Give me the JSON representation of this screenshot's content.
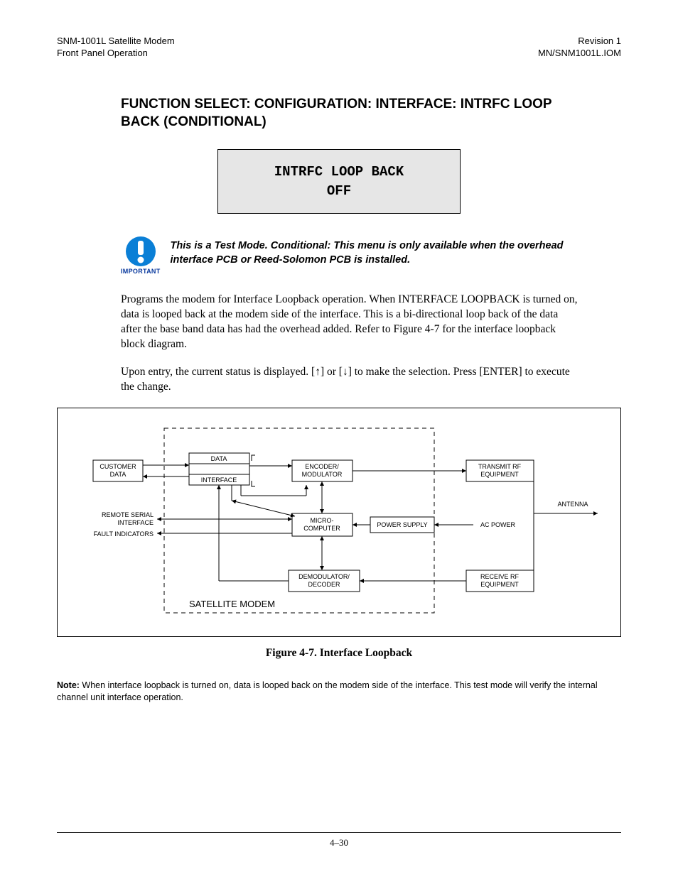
{
  "header": {
    "left1": "SNM-1001L Satellite Modem",
    "left2": "Front Panel Operation",
    "right1": "Revision 1",
    "right2": "MN/SNM1001L.IOM"
  },
  "title": "FUNCTION SELECT: CONFIGURATION: INTERFACE: INTRFC LOOP BACK (CONDITIONAL)",
  "lcd": {
    "line1": "INTRFC LOOP BACK",
    "line2": "OFF"
  },
  "important": {
    "label": "IMPORTANT",
    "text": "This is a Test Mode. Conditional: This menu is only available when the overhead interface PCB or Reed-Solomon PCB is installed."
  },
  "para1": "Programs the modem for Interface Loopback operation. When INTERFACE LOOPBACK is turned on, data is looped back at the modem side of the interface. This is a bi-directional loop back of the data after the base band data has had the overhead added. Refer to Figure 4-7 for the interface loopback block diagram.",
  "para2_a": "Upon entry, the current status is displayed. [",
  "para2_b": "] or [",
  "para2_c": "] to make the selection. Press [ENTER] to execute the change.",
  "diagram": {
    "customer_data": "CUSTOMER\nDATA",
    "data": "DATA",
    "interface": "INTERFACE",
    "encoder": "ENCODER/\nMODULATOR",
    "transmit_rf": "TRANSMIT RF\nEQUIPMENT",
    "remote_serial": "REMOTE SERIAL\nINTERFACE",
    "fault_indicators": "FAULT INDICATORS",
    "micro": "MICRO-\nCOMPUTER",
    "power_supply": "POWER SUPPLY",
    "ac_power": "AC POWER",
    "antenna": "ANTENNA",
    "demod": "DEMODULATOR/\nDECODER",
    "receive_rf": "RECEIVE RF\nEQUIPMENT",
    "satellite_modem": "SATELLITE MODEM"
  },
  "figure_caption": "Figure 4-7.  Interface Loopback",
  "note_label": "Note:",
  "note_text": " When interface loopback is turned on, data is looped back on the modem side of the interface. This test mode will verify the internal channel unit interface operation.",
  "footer": "4–30"
}
